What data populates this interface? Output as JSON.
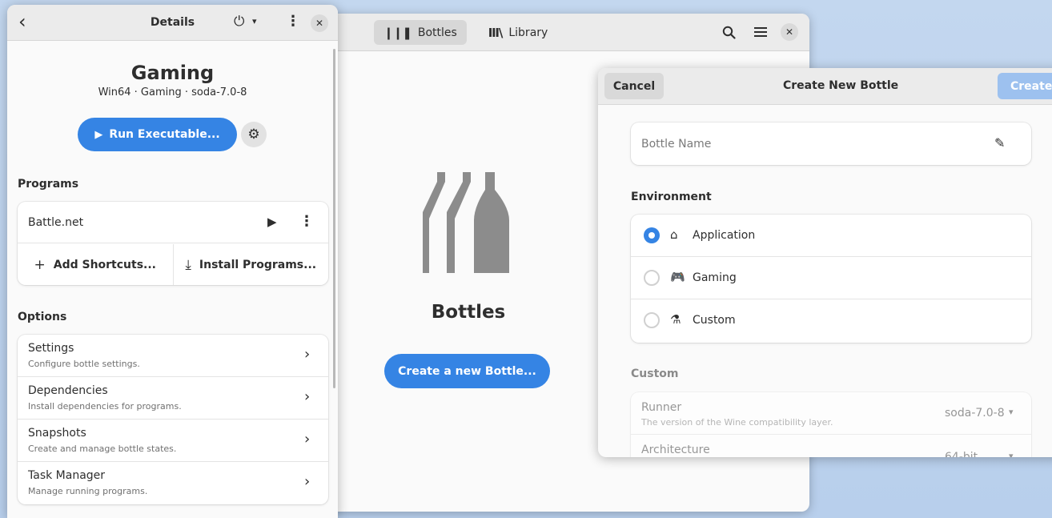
{
  "main_window": {
    "tabs": [
      {
        "icon": "bottles-icon",
        "glyph": "❙❙❚",
        "label": "Bottles",
        "active": true
      },
      {
        "icon": "library-icon",
        "glyph": "Ⅲ\\",
        "label": "Library",
        "active": false
      }
    ],
    "search_glyph": "🔍",
    "menu_glyph": "☰",
    "close_glyph": "✕",
    "empty_state": {
      "title": "Bottles",
      "create_button": "Create a new Bottle..."
    }
  },
  "details": {
    "header": {
      "back_glyph": "‹",
      "title": "Details",
      "power_glyph": "⏻",
      "caret_glyph": "▾",
      "kebab_glyph": "⋮",
      "close_glyph": "✕"
    },
    "bottle": {
      "name": "Gaming",
      "meta": "Win64 · Gaming · soda-7.0-8"
    },
    "run_button": {
      "glyph": "▶",
      "label": "Run Executable..."
    },
    "gear_glyph": "⚙",
    "programs": {
      "heading": "Programs",
      "items": [
        {
          "name": "Battle.net",
          "play_glyph": "▶",
          "kebab_glyph": "⋮"
        }
      ],
      "add_shortcuts": {
        "glyph": "+",
        "label": "Add Shortcuts..."
      },
      "install_programs": {
        "glyph": "⤓",
        "label": "Install Programs..."
      }
    },
    "options": {
      "heading": "Options",
      "chevron_glyph": "›",
      "items": [
        {
          "title": "Settings",
          "subtitle": "Configure bottle settings."
        },
        {
          "title": "Dependencies",
          "subtitle": "Install dependencies for programs."
        },
        {
          "title": "Snapshots",
          "subtitle": "Create and manage bottle states."
        },
        {
          "title": "Task Manager",
          "subtitle": "Manage running programs."
        }
      ]
    }
  },
  "dialog": {
    "title": "Create New Bottle",
    "cancel": "Cancel",
    "create": "Create",
    "name_field": {
      "placeholder": "Bottle Name",
      "value": "",
      "edit_glyph": "✎"
    },
    "environment": {
      "heading": "Environment",
      "options": [
        {
          "label": "Application",
          "glyph": "⌂",
          "selected": true
        },
        {
          "label": "Gaming",
          "glyph": "🎮",
          "selected": false
        },
        {
          "label": "Custom",
          "glyph": "⚗",
          "selected": false
        }
      ]
    },
    "custom": {
      "heading": "Custom",
      "runner": {
        "title": "Runner",
        "subtitle": "The version of the Wine compatibility layer.",
        "value": "soda-7.0-8",
        "caret": "▾"
      },
      "architecture": {
        "title": "Architecture",
        "value": "64-bit",
        "caret": "▾"
      }
    }
  },
  "colors": {
    "accent": "#3584e4",
    "accent_disabled": "#9dc1ef",
    "bottle_art": "#8c8c8c",
    "desktop": "#c3d7ef"
  }
}
